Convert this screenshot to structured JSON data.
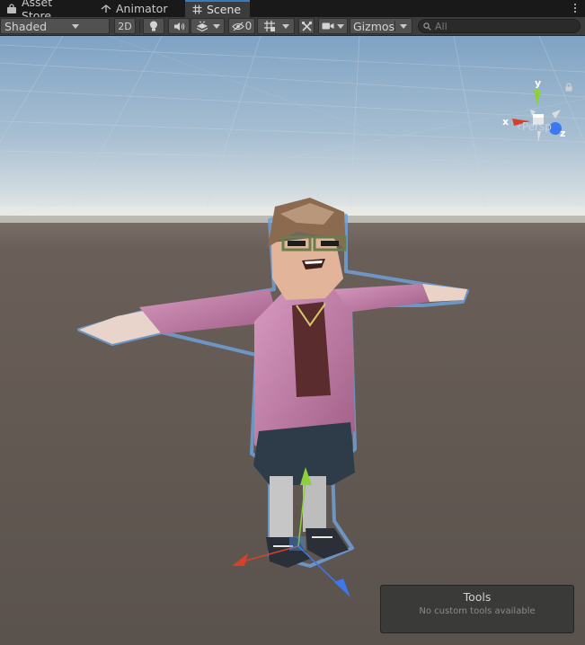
{
  "tabs": [
    {
      "label": "Asset Store",
      "icon": "shopping-bag-icon",
      "active": false
    },
    {
      "label": "Animator",
      "icon": "animator-icon",
      "active": false
    },
    {
      "label": "Scene",
      "icon": "grid-hash-icon",
      "active": true
    }
  ],
  "toolbar": {
    "draw_mode": "Shaded",
    "toggle_2d": "2D",
    "hidden_count": "0",
    "gizmos_label": "Gizmos",
    "search_placeholder": "All"
  },
  "viewport": {
    "projection_label": "Persp",
    "axis_labels": {
      "x": "x",
      "y": "y",
      "z": "z"
    }
  },
  "tools_overlay": {
    "title": "Tools",
    "message": "No custom tools available"
  },
  "colors": {
    "tab_accent": "#3a79bb",
    "x_axis": "#d8402a",
    "y_axis": "#8cd13a",
    "z_axis": "#3c79ee",
    "selection_outline": "#6fa0d8"
  }
}
